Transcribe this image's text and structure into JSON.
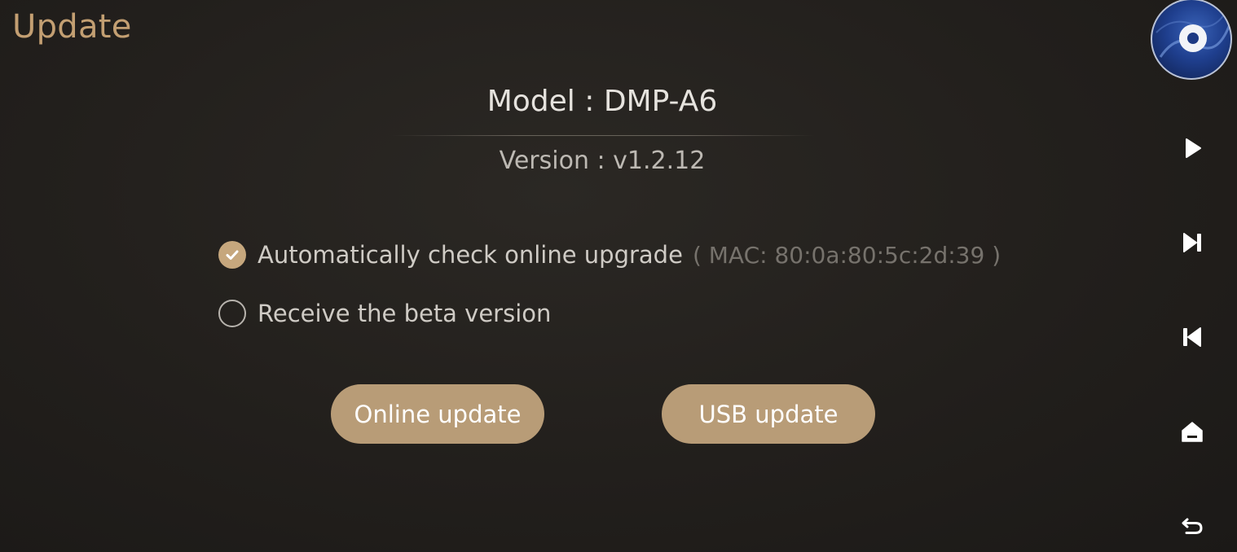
{
  "page": {
    "title": "Update"
  },
  "device": {
    "model_text": "Model : DMP-A6",
    "version_text": "Version : v1.2.12"
  },
  "options": {
    "auto_check": {
      "label": "Automatically check online upgrade",
      "mac_text": "( MAC: 80:0a:80:5c:2d:39 )",
      "checked": true
    },
    "beta": {
      "label": "Receive the beta version",
      "checked": false
    }
  },
  "buttons": {
    "online_update": "Online update",
    "usb_update": "USB update"
  },
  "sidebar": {
    "items": [
      {
        "icon": "album-art-avatar"
      },
      {
        "icon": "play-icon"
      },
      {
        "icon": "next-track-icon"
      },
      {
        "icon": "previous-track-icon"
      },
      {
        "icon": "home-icon"
      },
      {
        "icon": "back-icon"
      }
    ]
  },
  "colors": {
    "accent": "#c39f72",
    "button": "#b89c77",
    "background": "#221f1c"
  }
}
